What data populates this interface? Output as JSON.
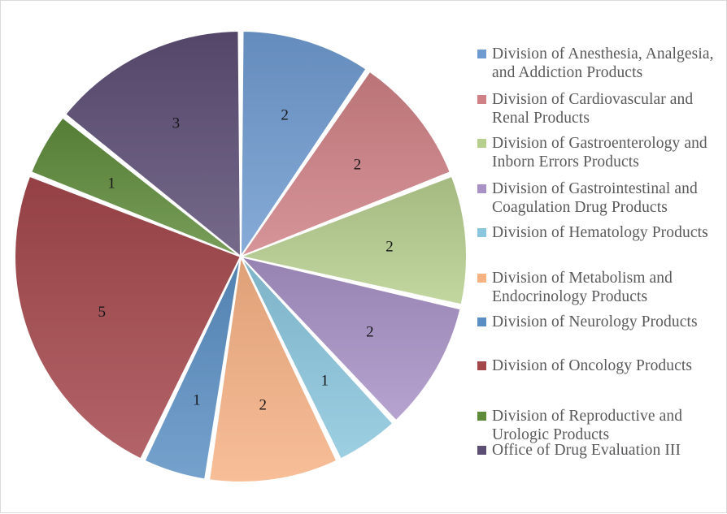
{
  "chart_data": {
    "type": "pie",
    "title": "",
    "categories": [
      "Division of Anesthesia, Analgesia, and Addiction Products",
      "Division of Cardiovascular and Renal Products",
      "Division of Gastroenterology and Inborn Errors Products",
      "Division of Gastrointestinal and Coagulation Drug Products",
      "Division of Hematology Products",
      "Division of Metabolism and Endocrinology Products",
      "Division of Neurology Products",
      "Division of Oncology Products",
      "Division of Reproductive and Urologic Products",
      "Office of Drug Evaluation III"
    ],
    "values": [
      2,
      2,
      2,
      2,
      1,
      2,
      1,
      5,
      1,
      3
    ],
    "data_labels": [
      "2",
      "2",
      "2",
      "2",
      "1",
      "2",
      "1",
      "5",
      "1",
      "3"
    ],
    "colors": [
      "#6f9bd1",
      "#cf8185",
      "#b6ce8e",
      "#a891c6",
      "#8ac6dd",
      "#f7b284",
      "#5b8fc4",
      "#a4474b",
      "#5e8b3a",
      "#5c4e75"
    ],
    "total": 21,
    "start_angle_deg": 0,
    "direction": "clockwise",
    "legend_position": "right",
    "grid": false,
    "slice_gap": true
  },
  "legend": {
    "items": [
      {
        "label": "Division of Anesthesia, Analgesia, and Addiction Products",
        "color": "#6f9bd1",
        "value": 2
      },
      {
        "label": "Division of Cardiovascular and Renal Products",
        "color": "#cf8185",
        "value": 2
      },
      {
        "label": "Division of Gastroenterology and Inborn Errors Products",
        "color": "#b6ce8e",
        "value": 2
      },
      {
        "label": "Division of Gastrointestinal and Coagulation Drug Products",
        "color": "#a891c6",
        "value": 2
      },
      {
        "label": "Division of Hematology Products",
        "color": "#8ac6dd",
        "value": 1
      },
      {
        "label": "Division of Metabolism and Endocrinology Products",
        "color": "#f7b284",
        "value": 2
      },
      {
        "label": "Division of Neurology Products",
        "color": "#5b8fc4",
        "value": 1
      },
      {
        "label": "Division of Oncology Products",
        "color": "#a4474b",
        "value": 5
      },
      {
        "label": "Division of Reproductive and Urologic Products",
        "color": "#5e8b3a",
        "value": 1
      },
      {
        "label": "Office of Drug Evaluation III",
        "color": "#5c4e75",
        "value": 3
      }
    ]
  },
  "frame": {
    "border_color": "#d9d9d9",
    "background_color": "#ffffff"
  }
}
